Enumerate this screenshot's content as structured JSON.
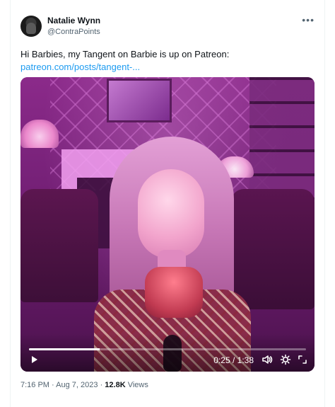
{
  "tweet": {
    "author": {
      "name": "Natalie Wynn",
      "handle": "@ContraPoints"
    },
    "more_icon": "more-horizontal-icon",
    "text": "Hi Barbies, my Tangent on Barbie is up on Patreon:",
    "link_text": "patreon.com/posts/tangent-...",
    "video": {
      "current_time": "0:25",
      "duration": "1:38",
      "time_display": "0:25 / 1:38",
      "progress_fraction": 0.255,
      "icons": {
        "play": "play-icon",
        "volume": "volume-icon",
        "settings": "settings-gear-icon",
        "fullscreen": "fullscreen-icon"
      }
    },
    "meta": {
      "time": "7:16 PM",
      "date": "Aug 7, 2023",
      "views_count": "12.8K",
      "views_label": "Views"
    },
    "colors": {
      "link": "#1d9bf0",
      "secondary_text": "#536471",
      "text": "#0f1419"
    }
  }
}
